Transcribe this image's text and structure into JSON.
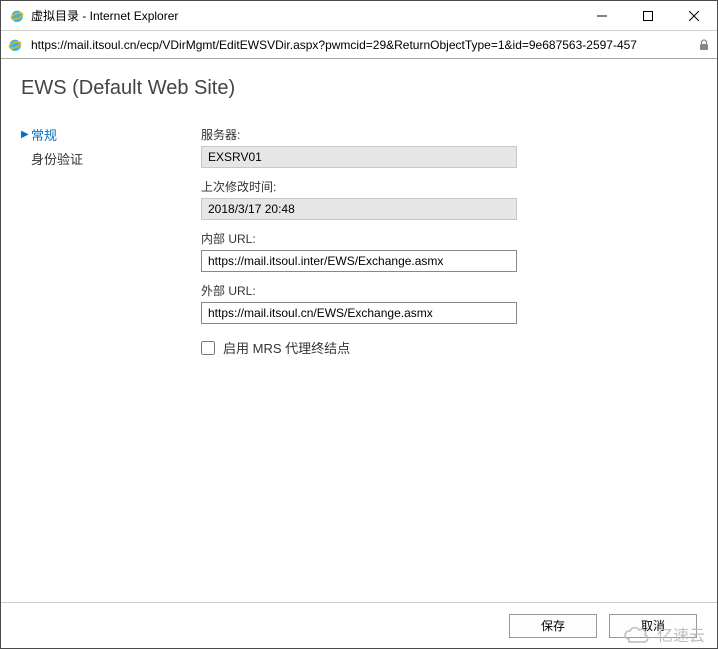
{
  "window": {
    "title": "虚拟目录 - Internet Explorer",
    "url": "https://mail.itsoul.cn/ecp/VDirMgmt/EditEWSVDir.aspx?pwmcid=29&ReturnObjectType=1&id=9e687563-2597-457"
  },
  "page": {
    "heading": "EWS (Default Web Site)"
  },
  "sidenav": {
    "items": [
      {
        "label": "常规",
        "active": true
      },
      {
        "label": "身份验证",
        "active": false
      }
    ]
  },
  "form": {
    "server_label": "服务器:",
    "server_value": "EXSRV01",
    "modified_label": "上次修改时间:",
    "modified_value": "2018/3/17 20:48",
    "internal_url_label": "内部 URL:",
    "internal_url_value": "https://mail.itsoul.inter/EWS/Exchange.asmx",
    "external_url_label": "外部 URL:",
    "external_url_value": "https://mail.itsoul.cn/EWS/Exchange.asmx",
    "mrs_checkbox_label": "启用 MRS 代理终结点"
  },
  "footer": {
    "save": "保存",
    "cancel": "取消"
  },
  "watermark": "亿速云"
}
